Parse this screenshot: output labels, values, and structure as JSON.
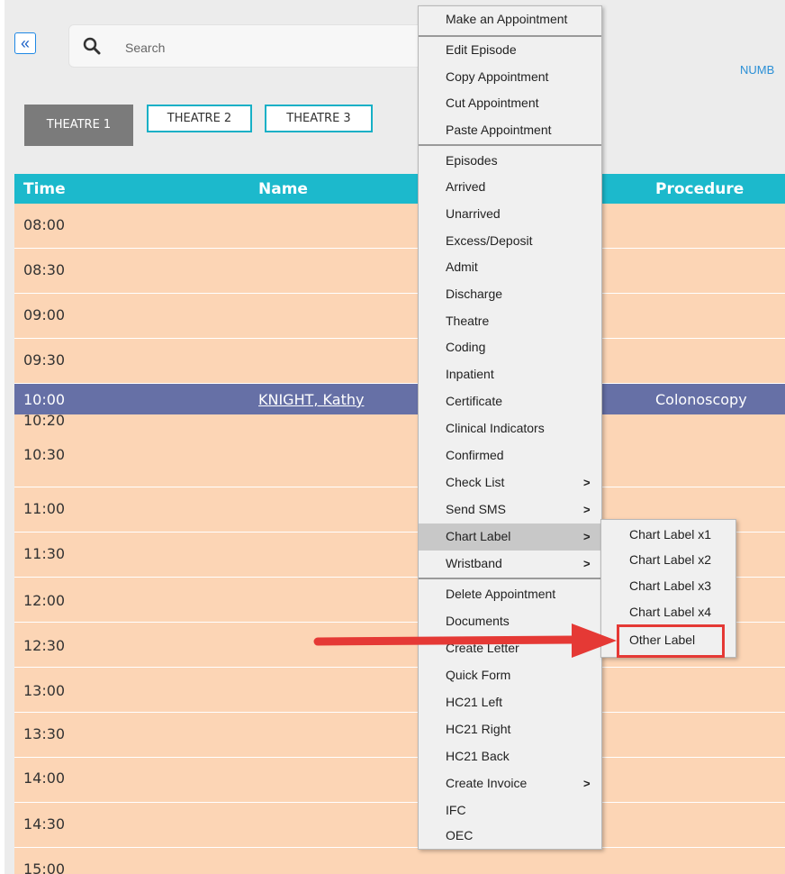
{
  "toolbar": {
    "collapse_icon": "double-chevron-left-icon",
    "search_placeholder": "Search",
    "numb_label": "NUMB"
  },
  "theatre_tabs": [
    {
      "label": "THEATRE 1",
      "active": true
    },
    {
      "label": "THEATRE 2",
      "active": false
    },
    {
      "label": "THEATRE 3",
      "active": false
    }
  ],
  "table": {
    "headers": {
      "time": "Time",
      "name": "Name",
      "procedure": "Procedure"
    },
    "rows": [
      {
        "time": "08:00"
      },
      {
        "time": "08:30"
      },
      {
        "time": "09:00"
      },
      {
        "time": "09:30"
      },
      {
        "time": "10:00",
        "name": "KNIGHT, Kathy",
        "procedure": "Colonoscopy",
        "booked": true
      },
      {
        "time": "10:20"
      },
      {
        "time": "10:30"
      },
      {
        "time": "11:00"
      },
      {
        "time": "11:30"
      },
      {
        "time": "12:00"
      },
      {
        "time": "12:30"
      },
      {
        "time": "13:00"
      },
      {
        "time": "13:30"
      },
      {
        "time": "14:00"
      },
      {
        "time": "14:30"
      },
      {
        "time": "15:00"
      }
    ]
  },
  "context_menu": {
    "items": [
      {
        "label": "Make an Appointment"
      },
      {
        "label": "Edit Episode"
      },
      {
        "label": "Copy Appointment"
      },
      {
        "label": "Cut Appointment"
      },
      {
        "label": "Paste Appointment"
      },
      {
        "label": "Episodes"
      },
      {
        "label": "Arrived"
      },
      {
        "label": "Unarrived"
      },
      {
        "label": "Excess/Deposit"
      },
      {
        "label": "Admit"
      },
      {
        "label": "Discharge"
      },
      {
        "label": "Theatre"
      },
      {
        "label": "Coding"
      },
      {
        "label": "Inpatient"
      },
      {
        "label": "Certificate"
      },
      {
        "label": "Clinical Indicators"
      },
      {
        "label": "Confirmed"
      },
      {
        "label": "Check List",
        "submenu": ">"
      },
      {
        "label": "Send SMS",
        "submenu": ">"
      },
      {
        "label": "Chart Label",
        "submenu": ">",
        "highlighted": true
      },
      {
        "label": "Wristband",
        "submenu": ">"
      },
      {
        "label": "Delete Appointment"
      },
      {
        "label": "Documents"
      },
      {
        "label": "Create Letter"
      },
      {
        "label": "Quick Form"
      },
      {
        "label": "HC21 Left"
      },
      {
        "label": "HC21 Right"
      },
      {
        "label": "HC21 Back"
      },
      {
        "label": "Create Invoice",
        "submenu": ">"
      },
      {
        "label": "IFC"
      },
      {
        "label": "OEC"
      }
    ]
  },
  "chart_label_submenu": {
    "items": [
      "Chart Label x1",
      "Chart Label x2",
      "Chart Label x3",
      "Chart Label x4",
      "Other Label"
    ],
    "highlighted": "Other Label"
  },
  "colors": {
    "header": "#1cb9cc",
    "slot": "#fcd5b5",
    "booked": "#6670a6",
    "annotation": "#e53935"
  }
}
